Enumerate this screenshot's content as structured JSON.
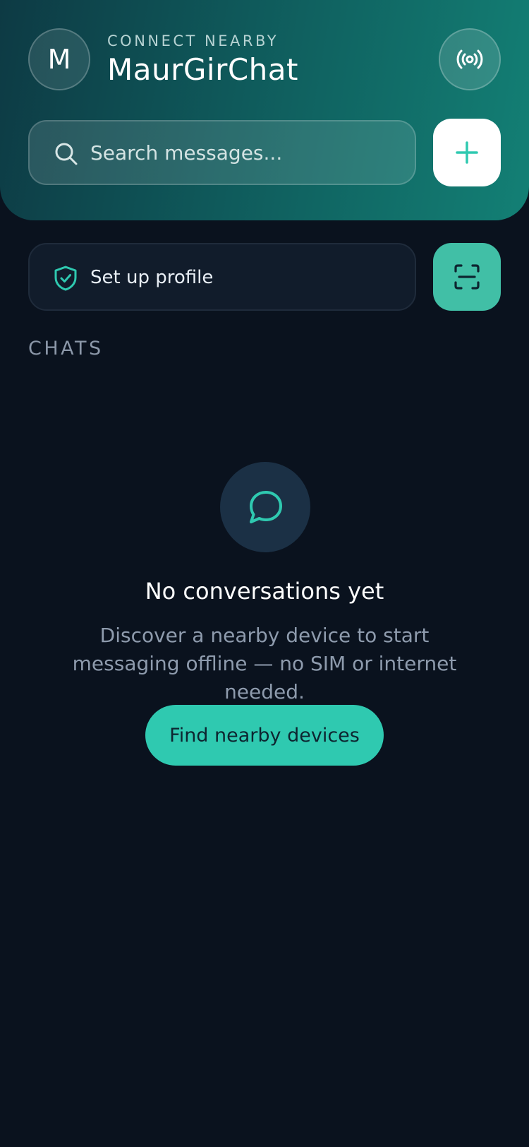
{
  "header": {
    "avatar_initial": "M",
    "eyebrow": "CONNECT NEARBY",
    "title": "MaurGirChat",
    "broadcast_icon": "broadcast-icon"
  },
  "search": {
    "placeholder": "Search messages...",
    "value": "",
    "icon": "search-icon"
  },
  "add_button": {
    "icon": "plus-icon"
  },
  "profile": {
    "label": "Set up profile",
    "icon": "shield-check-icon"
  },
  "scan_button": {
    "icon": "scan-icon"
  },
  "chats": {
    "section_label": "CHATS",
    "empty_state": {
      "icon": "chat-bubble-icon",
      "title": "No conversations yet",
      "description": "Discover a nearby device to start messaging offline — no SIM or internet needed.",
      "action_label": "Find nearby devices"
    }
  },
  "colors": {
    "background": "#0a121e",
    "accent": "#2fc9b0",
    "accent_muted": "#41bfa6",
    "header_gradient_start": "#0d3a44",
    "header_gradient_end": "#138075"
  }
}
